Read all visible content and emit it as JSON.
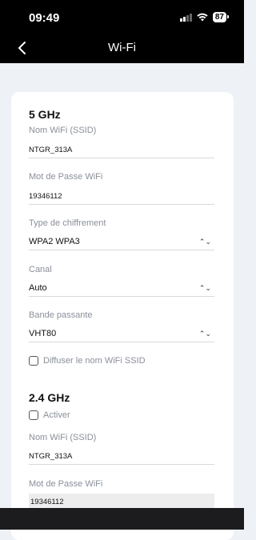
{
  "status_bar": {
    "time": "09:49",
    "battery": "87"
  },
  "nav": {
    "title": "Wi-Fi"
  },
  "band_5": {
    "title": "5 GHz",
    "ssid_label": "Nom WiFi (SSID)",
    "ssid_value": "NTGR_313A",
    "password_label": "Mot de Passe WiFi",
    "password_value": "19346112",
    "encryption_label": "Type de chiffrement",
    "encryption_value": "WPA2 WPA3",
    "channel_label": "Canal",
    "channel_value": "Auto",
    "bandwidth_label": "Bande passante",
    "bandwidth_value": "VHT80",
    "broadcast_label": "Diffuser le nom WiFi SSID",
    "broadcast_checked": false
  },
  "band_24": {
    "title": "2.4 GHz",
    "enable_label": "Activer",
    "enable_checked": false,
    "ssid_label": "Nom WiFi (SSID)",
    "ssid_value": "NTGR_313A",
    "password_label": "Mot de Passe WiFi",
    "password_value": "19346112"
  },
  "colors": {
    "background": "#eef1f6",
    "bars": "#000000",
    "muted_text": "#8a8f99"
  }
}
